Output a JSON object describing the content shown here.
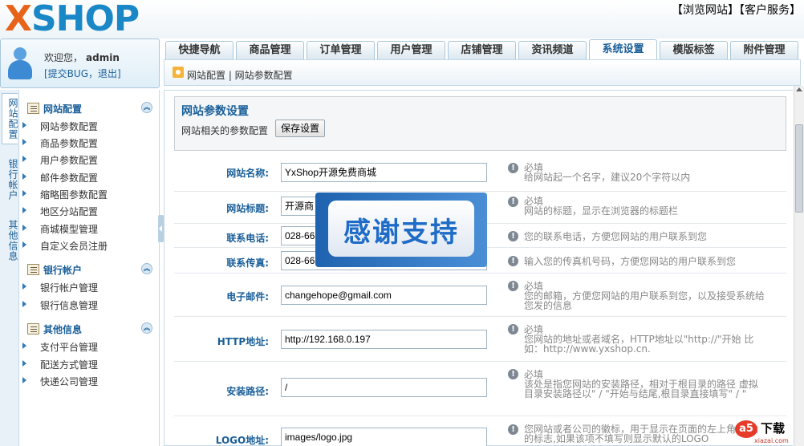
{
  "header": {
    "logo_text": "XSHOP",
    "logo_x": "X",
    "logo_rest": "SHOP",
    "top_links": "【浏览网站】【客户服务】"
  },
  "user": {
    "welcome": "欢迎您，",
    "name": "admin",
    "links": "[提交BUG，退出]"
  },
  "tabs": [
    {
      "label": "快捷导航"
    },
    {
      "label": "商品管理"
    },
    {
      "label": "订单管理"
    },
    {
      "label": "用户管理"
    },
    {
      "label": "店铺管理"
    },
    {
      "label": "资讯频道"
    },
    {
      "label": "系统设置"
    },
    {
      "label": "模版标签"
    },
    {
      "label": "附件管理"
    }
  ],
  "active_tab": "系统设置",
  "breadcrumb": "网站配置 | 网站参数配置",
  "side_tabs": [
    {
      "label": "网站配置"
    },
    {
      "label": "银行帐户"
    },
    {
      "label": "其他信息"
    }
  ],
  "tree": {
    "groups": [
      {
        "title": "网站配置",
        "items": [
          "网站参数配置",
          "商品参数配置",
          "用户参数配置",
          "邮件参数配置",
          "缩略图参数配置",
          "地区分站配置",
          "商城模型管理",
          "自定义会员注册"
        ]
      },
      {
        "title": "银行帐户",
        "items": [
          "银行帐户管理",
          "银行信息管理"
        ]
      },
      {
        "title": "其他信息",
        "items": [
          "支付平台管理",
          "配送方式管理",
          "快递公司管理"
        ]
      }
    ]
  },
  "main": {
    "section_title": "网站参数设置",
    "section_desc": "网站相关的参数配置",
    "save_label": "保存设置",
    "rows": [
      {
        "label": "网站名称:",
        "value": "YxShop开源免费商城",
        "required": "必填",
        "hint": "给网站起一个名字，建议20个字符以内"
      },
      {
        "label": "网站标题:",
        "value": "开源商",
        "required": "必填",
        "hint": "网站的标题，显示在浏览器的标题栏"
      },
      {
        "label": "联系电话:",
        "value": "028-66",
        "required": "",
        "hint": "您的联系电话，方便您网站的用户联系到您"
      },
      {
        "label": "联系传真:",
        "value": "028-66",
        "required": "",
        "hint": "输入您的传真机号码，方便您网站的用户联系到您"
      },
      {
        "label": "电子邮件:",
        "value": "changehope@gmail.com",
        "required": "必填",
        "hint": "您的邮箱，方便您网站的用户联系到您，以及接受系统给您发的信息"
      },
      {
        "label": "HTTP地址:",
        "value": "http://192.168.0.197",
        "required": "必填",
        "hint": "您网站的地址或者域名，HTTP地址以\"http://\"开始 比如：http://www.yxshop.cn."
      },
      {
        "label": "安装路径:",
        "value": "/",
        "required": "必填",
        "hint": "该处是指您网站的安装路径，相对于根目录的路径 虚拟目录安装路径以\" / \"开始与结尾,根目录直接填写\" / \""
      },
      {
        "label": "LOGO地址:",
        "value": "images/logo.jpg",
        "required": "",
        "hint": "您网站或者公司的徽标，用于显示在页面的左上角 网站的标志,如果该项不填写则显示默认的LOGO"
      }
    ]
  },
  "banner": {
    "text": "感谢支持"
  },
  "watermark": {
    "logo": "a5",
    "label": "下载",
    "site": "xiazai.com"
  }
}
